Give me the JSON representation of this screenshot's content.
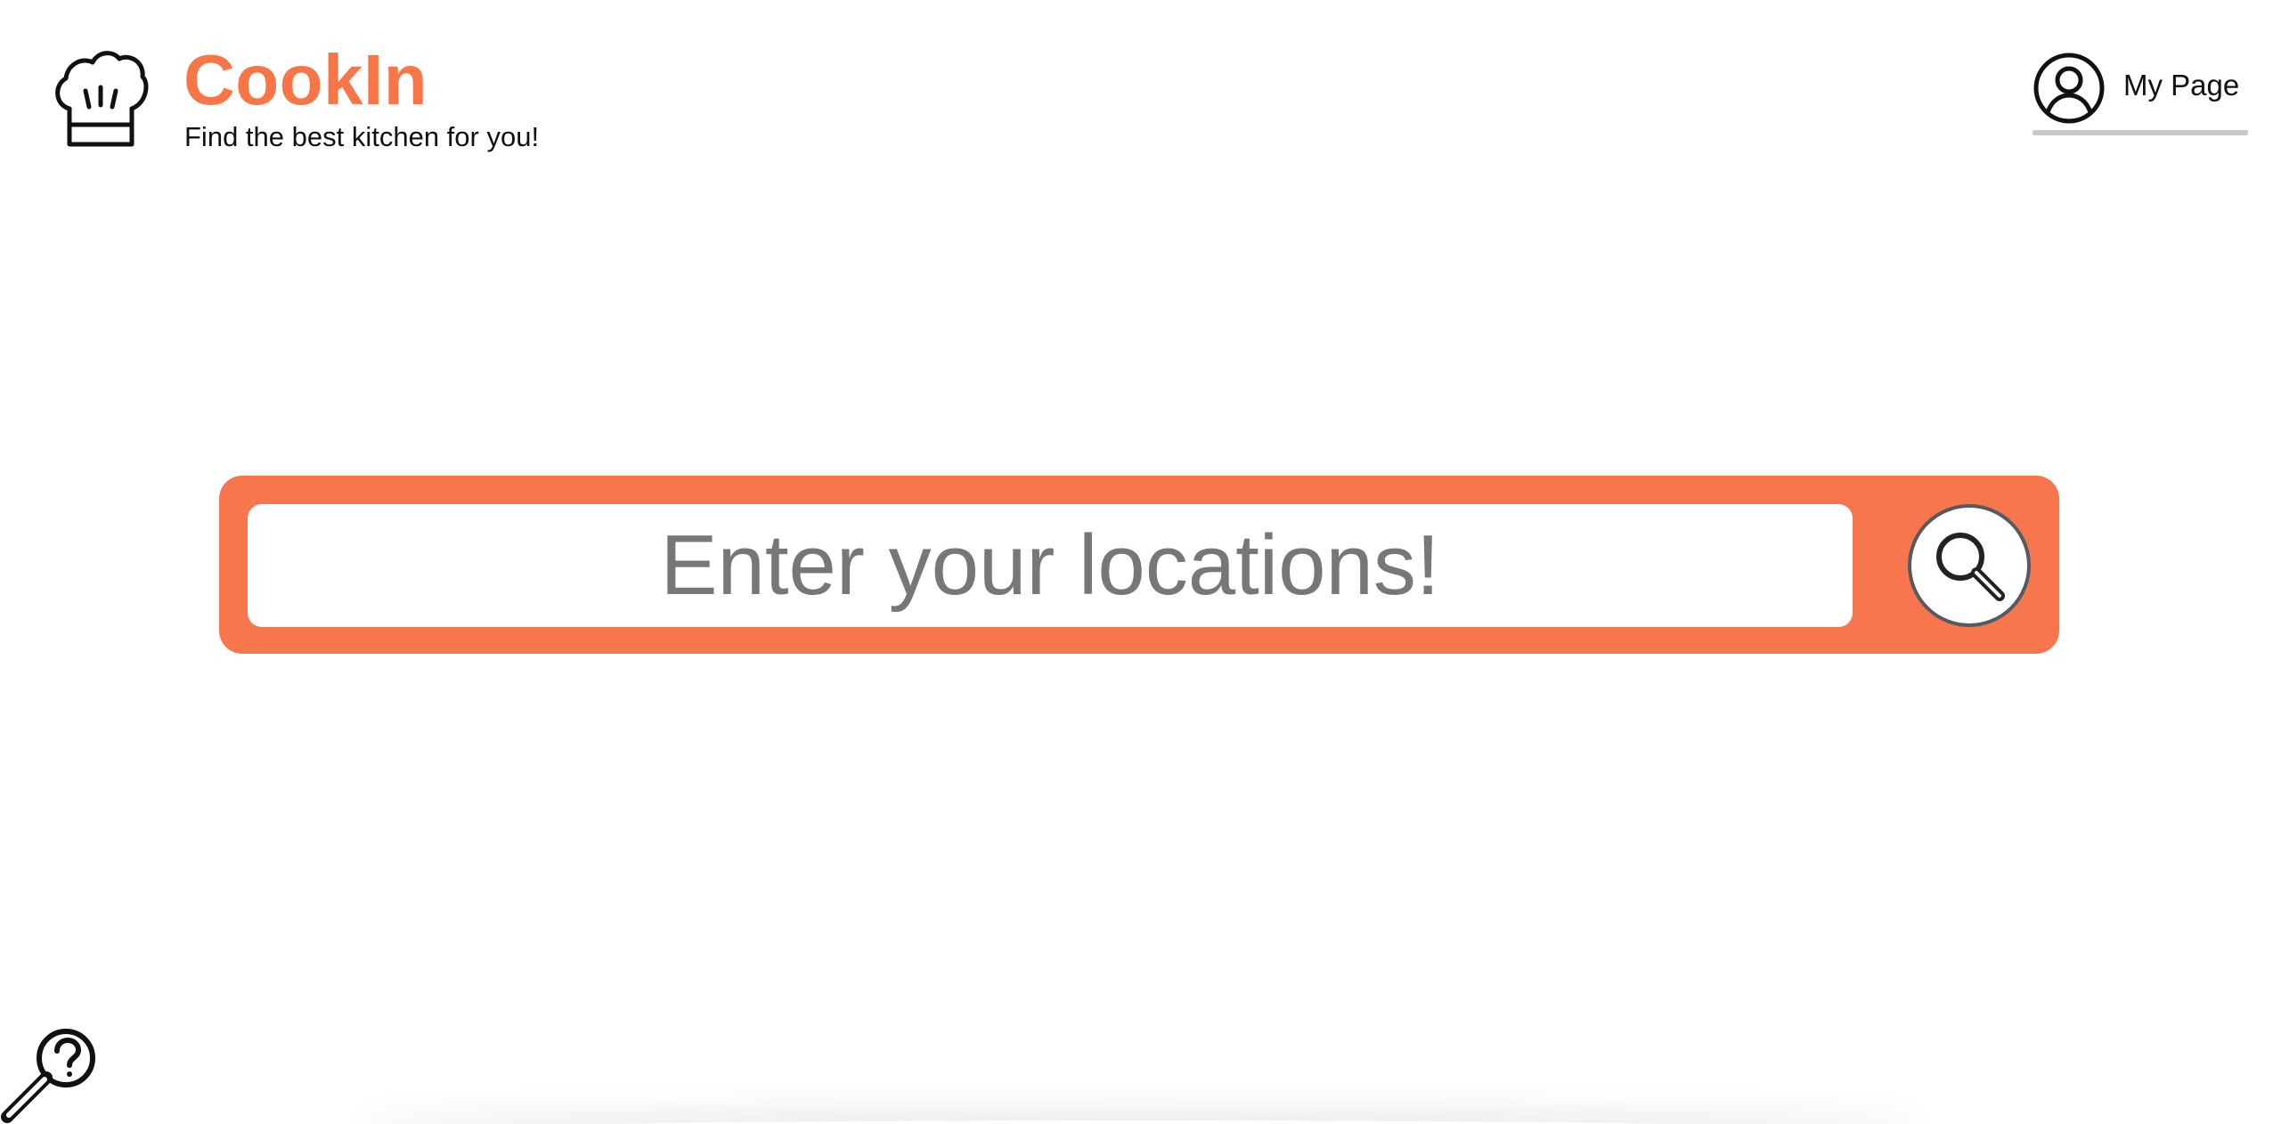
{
  "brand": {
    "name": "CookIn",
    "tagline": "Find the best kitchen for you!",
    "logo_icon": "chef-hat-icon",
    "accent_color": "#f87548"
  },
  "header": {
    "mypage_label": "My Page",
    "mypage_icon": "user-circle-icon"
  },
  "search": {
    "placeholder": "Enter your locations!",
    "value": "",
    "button_icon": "search-icon",
    "panel_color": "#f8764d"
  },
  "help": {
    "icon": "help-magnifier-icon"
  }
}
